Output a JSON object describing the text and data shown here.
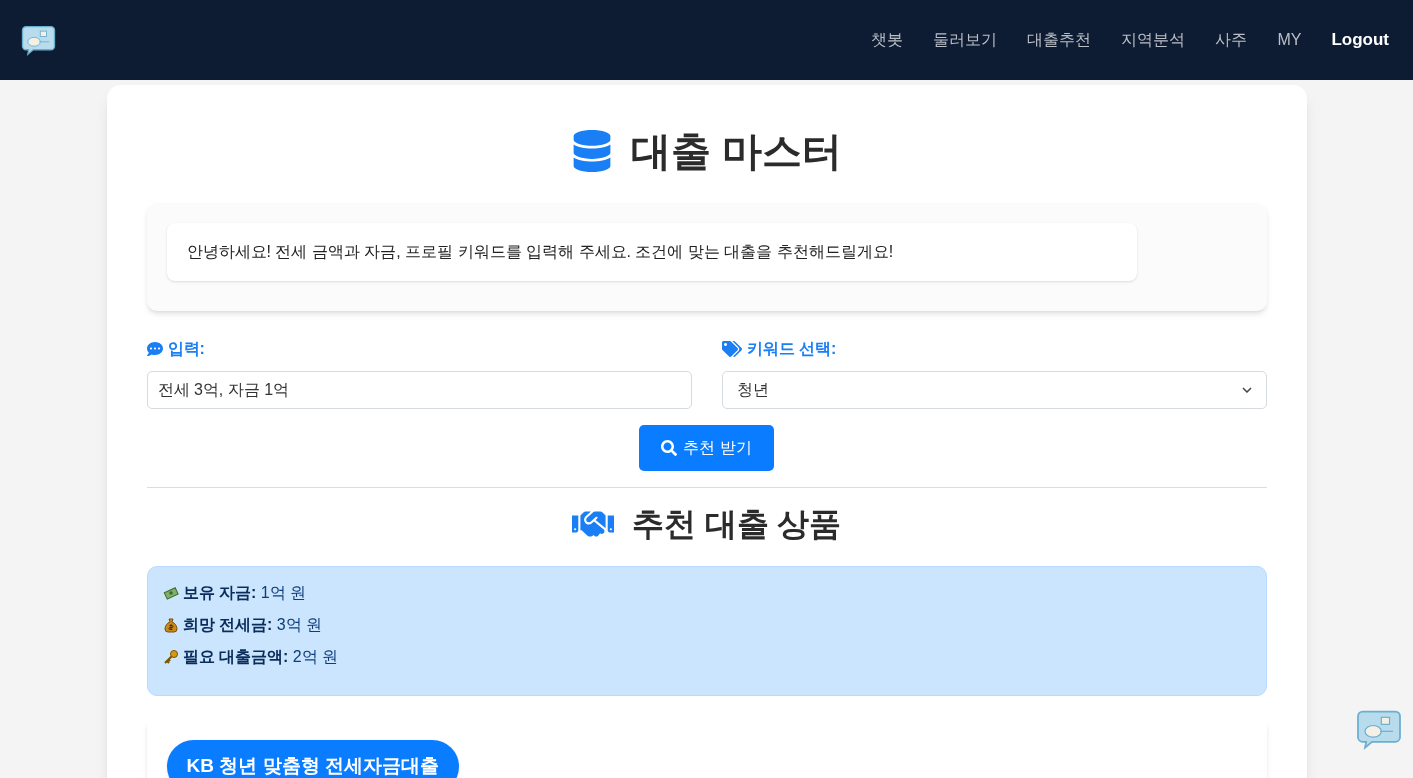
{
  "nav": {
    "items": [
      {
        "label": "챗봇",
        "kind": "link"
      },
      {
        "label": "둘러보기",
        "kind": "link"
      },
      {
        "label": "대출추천",
        "kind": "link"
      },
      {
        "label": "지역분석",
        "kind": "link"
      },
      {
        "label": "사주",
        "kind": "link"
      },
      {
        "label": "MY",
        "kind": "link"
      },
      {
        "label": "Logout",
        "kind": "strong"
      }
    ]
  },
  "title": "대출 마스터",
  "greeting": "안녕하세요! 전세 금액과 자금, 프로필 키워드를 입력해 주세요. 조건에 맞는 대출을 추천해드릴게요!",
  "input": {
    "label": "입력:",
    "value": "전세 3억, 자금 1억"
  },
  "keyword": {
    "label": "키워드 선택:",
    "value": "청년"
  },
  "submit": "추천 받기",
  "results_title": "추천 대출 상품",
  "summary": [
    {
      "kind": "cash",
      "label": "보유 자금:",
      "value": "1억 원"
    },
    {
      "kind": "bag",
      "label": "희망 전세금:",
      "value": "3억 원"
    },
    {
      "kind": "key",
      "label": "필요 대출금액:",
      "value": "2억 원"
    }
  ],
  "product": {
    "name": "KB 청년 맞춤형 전세자금대출"
  }
}
